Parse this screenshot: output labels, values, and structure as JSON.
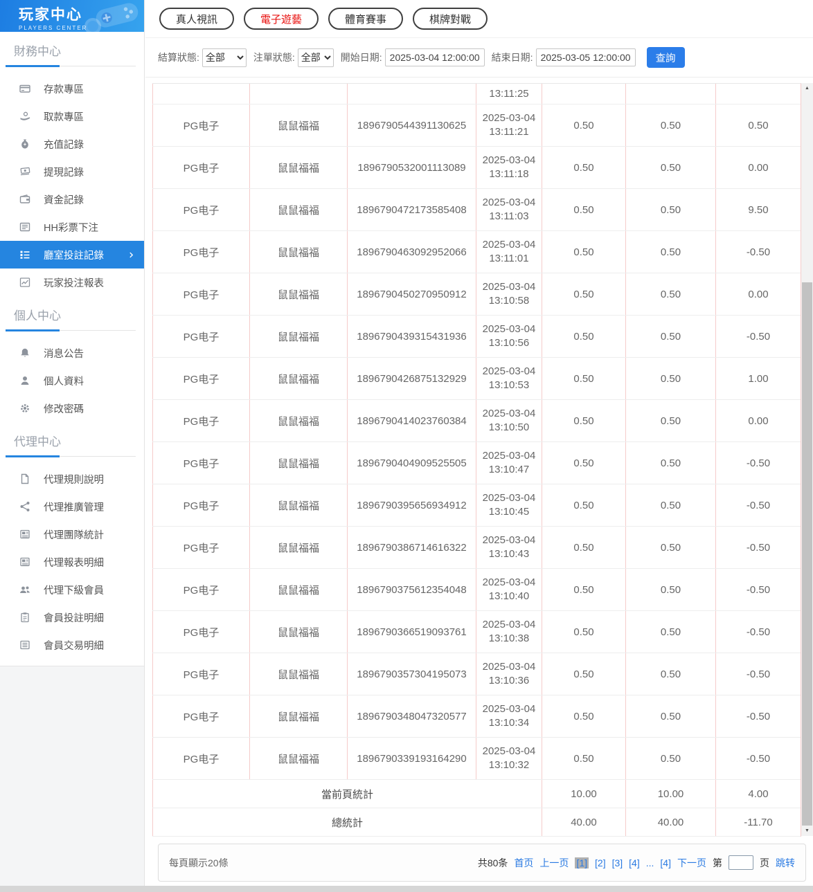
{
  "theme": {
    "accent_blue": "#2585e0",
    "button_blue": "#2b7de9",
    "link_blue": "#2a7ae2",
    "active_tab_red": "#e8110f",
    "header_gradient": [
      "#1d7de2",
      "#36a3ee"
    ],
    "table_column_border": "#f5cbca"
  },
  "sidebar": {
    "title": "玩家中心",
    "subtitle": "PLAYERS CENTER",
    "sections": [
      {
        "label": "財務中心",
        "items": [
          {
            "icon": "card-icon",
            "label": "存款專區"
          },
          {
            "icon": "hand-coin-icon",
            "label": "取款專區"
          },
          {
            "icon": "moneybag-icon",
            "label": "充值記錄"
          },
          {
            "icon": "banknote-icon",
            "label": "提現記錄"
          },
          {
            "icon": "wallet-icon",
            "label": "資金記錄"
          },
          {
            "icon": "list-icon",
            "label": "HH彩票下注"
          },
          {
            "icon": "rows-icon",
            "label": "廳室投註記錄",
            "active": true
          },
          {
            "icon": "chart-icon",
            "label": "玩家投注報表"
          }
        ]
      },
      {
        "label": "個人中心",
        "items": [
          {
            "icon": "bell-icon",
            "label": "消息公告"
          },
          {
            "icon": "user-icon",
            "label": "個人資料"
          },
          {
            "icon": "gear-icon",
            "label": "修改密碼"
          }
        ]
      },
      {
        "label": "代理中心",
        "items": [
          {
            "icon": "document-icon",
            "label": "代理規則說明"
          },
          {
            "icon": "share-icon",
            "label": "代理推廣管理"
          },
          {
            "icon": "news-icon",
            "label": "代理團隊統計"
          },
          {
            "icon": "news-icon",
            "label": "代理報表明細"
          },
          {
            "icon": "users-icon",
            "label": "代理下級會員"
          },
          {
            "icon": "clipboard-icon",
            "label": "會員投註明細"
          },
          {
            "icon": "list-alt-icon",
            "label": "會員交易明細"
          }
        ]
      }
    ]
  },
  "tabs": {
    "active_index": 1,
    "items": [
      "真人視訊",
      "電子遊藝",
      "體育賽事",
      "棋牌對戰"
    ]
  },
  "filters": {
    "settle_label": "結算狀態:",
    "settle_value": "全部",
    "order_label": "注單狀態:",
    "order_value": "全部",
    "start_label": "開始日期:",
    "start_value": "2025-03-04 12:00:00",
    "end_label": "結束日期:",
    "end_value": "2025-03-05 12:00:00",
    "search_label": "查詢"
  },
  "table": {
    "partial_row_time": "13:11:25",
    "rows": [
      {
        "provider": "PG电子",
        "game": "鼠鼠福福",
        "order": "1896790544391130625",
        "date": "2025-03-04",
        "time": "13:11:21",
        "bet": "0.50",
        "valid": "0.50",
        "result": "0.50"
      },
      {
        "provider": "PG电子",
        "game": "鼠鼠福福",
        "order": "1896790532001113089",
        "date": "2025-03-04",
        "time": "13:11:18",
        "bet": "0.50",
        "valid": "0.50",
        "result": "0.00"
      },
      {
        "provider": "PG电子",
        "game": "鼠鼠福福",
        "order": "1896790472173585408",
        "date": "2025-03-04",
        "time": "13:11:03",
        "bet": "0.50",
        "valid": "0.50",
        "result": "9.50"
      },
      {
        "provider": "PG电子",
        "game": "鼠鼠福福",
        "order": "1896790463092952066",
        "date": "2025-03-04",
        "time": "13:11:01",
        "bet": "0.50",
        "valid": "0.50",
        "result": "-0.50"
      },
      {
        "provider": "PG电子",
        "game": "鼠鼠福福",
        "order": "1896790450270950912",
        "date": "2025-03-04",
        "time": "13:10:58",
        "bet": "0.50",
        "valid": "0.50",
        "result": "0.00"
      },
      {
        "provider": "PG电子",
        "game": "鼠鼠福福",
        "order": "1896790439315431936",
        "date": "2025-03-04",
        "time": "13:10:56",
        "bet": "0.50",
        "valid": "0.50",
        "result": "-0.50"
      },
      {
        "provider": "PG电子",
        "game": "鼠鼠福福",
        "order": "1896790426875132929",
        "date": "2025-03-04",
        "time": "13:10:53",
        "bet": "0.50",
        "valid": "0.50",
        "result": "1.00"
      },
      {
        "provider": "PG电子",
        "game": "鼠鼠福福",
        "order": "1896790414023760384",
        "date": "2025-03-04",
        "time": "13:10:50",
        "bet": "0.50",
        "valid": "0.50",
        "result": "0.00"
      },
      {
        "provider": "PG电子",
        "game": "鼠鼠福福",
        "order": "1896790404909525505",
        "date": "2025-03-04",
        "time": "13:10:47",
        "bet": "0.50",
        "valid": "0.50",
        "result": "-0.50"
      },
      {
        "provider": "PG电子",
        "game": "鼠鼠福福",
        "order": "1896790395656934912",
        "date": "2025-03-04",
        "time": "13:10:45",
        "bet": "0.50",
        "valid": "0.50",
        "result": "-0.50"
      },
      {
        "provider": "PG电子",
        "game": "鼠鼠福福",
        "order": "1896790386714616322",
        "date": "2025-03-04",
        "time": "13:10:43",
        "bet": "0.50",
        "valid": "0.50",
        "result": "-0.50"
      },
      {
        "provider": "PG电子",
        "game": "鼠鼠福福",
        "order": "1896790375612354048",
        "date": "2025-03-04",
        "time": "13:10:40",
        "bet": "0.50",
        "valid": "0.50",
        "result": "-0.50"
      },
      {
        "provider": "PG电子",
        "game": "鼠鼠福福",
        "order": "1896790366519093761",
        "date": "2025-03-04",
        "time": "13:10:38",
        "bet": "0.50",
        "valid": "0.50",
        "result": "-0.50"
      },
      {
        "provider": "PG电子",
        "game": "鼠鼠福福",
        "order": "1896790357304195073",
        "date": "2025-03-04",
        "time": "13:10:36",
        "bet": "0.50",
        "valid": "0.50",
        "result": "-0.50"
      },
      {
        "provider": "PG电子",
        "game": "鼠鼠福福",
        "order": "1896790348047320577",
        "date": "2025-03-04",
        "time": "13:10:34",
        "bet": "0.50",
        "valid": "0.50",
        "result": "-0.50"
      },
      {
        "provider": "PG电子",
        "game": "鼠鼠福福",
        "order": "1896790339193164290",
        "date": "2025-03-04",
        "time": "13:10:32",
        "bet": "0.50",
        "valid": "0.50",
        "result": "-0.50"
      }
    ],
    "summary": [
      {
        "label": "當前頁統計",
        "bet": "10.00",
        "valid": "10.00",
        "result": "4.00"
      },
      {
        "label": "總統計",
        "bet": "40.00",
        "valid": "40.00",
        "result": "-11.70"
      }
    ]
  },
  "pagination": {
    "per_page_label": "每頁顯示20條",
    "total_label": "共80条",
    "items": [
      {
        "label": "首页",
        "type": "link"
      },
      {
        "label": "上一页",
        "type": "link"
      },
      {
        "label": "[1]",
        "type": "page",
        "current": true
      },
      {
        "label": "[2]",
        "type": "page"
      },
      {
        "label": "[3]",
        "type": "page"
      },
      {
        "label": "[4]",
        "type": "page"
      },
      {
        "label": "...",
        "type": "link"
      },
      {
        "label": "[4]",
        "type": "page"
      },
      {
        "label": "下一页",
        "type": "link"
      }
    ],
    "jump_pre": "第",
    "jump_input_value": "",
    "jump_post": "页",
    "jump_go": "跳转"
  }
}
